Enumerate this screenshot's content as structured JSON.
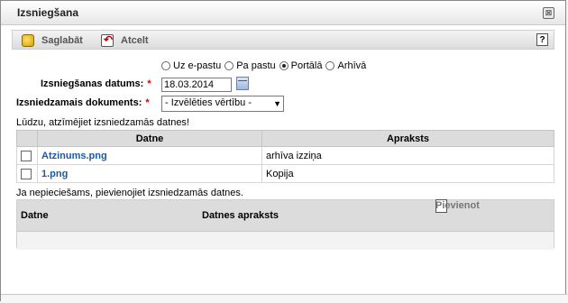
{
  "window": {
    "title": "Izsniegšana",
    "close_label": "⊠"
  },
  "toolbar": {
    "save_label": "Saglabāt",
    "cancel_label": "Atcelt",
    "help_label": "?"
  },
  "delivery": {
    "options": [
      {
        "label": "Uz e-pastu",
        "checked": false
      },
      {
        "label": "Pa pastu",
        "checked": false
      },
      {
        "label": "Portālā",
        "checked": true
      },
      {
        "label": "Arhīvā",
        "checked": false
      }
    ]
  },
  "form": {
    "date_label": "Izsniegšanas datums:",
    "date_value": "18.03.2014",
    "document_label": "Izsniedzamais dokuments:",
    "document_selected": "- Izvēlēties vērtību -",
    "required_mark": "*"
  },
  "files": {
    "instruction": "Lūdzu, atzīmējiet izsniedzamās datnes!",
    "headers": {
      "file": "Datne",
      "description": "Apraksts"
    },
    "rows": [
      {
        "file": "Atzinums.png",
        "description": "arhīva izziņa"
      },
      {
        "file": "1.png",
        "description": "Kopija"
      }
    ]
  },
  "upload": {
    "instruction": "Ja nepieciešams, pievienojiet izsniedzamās datnes.",
    "header_file": "Datne",
    "header_description": "Datnes apraksts",
    "add_label": "Pievienot"
  }
}
